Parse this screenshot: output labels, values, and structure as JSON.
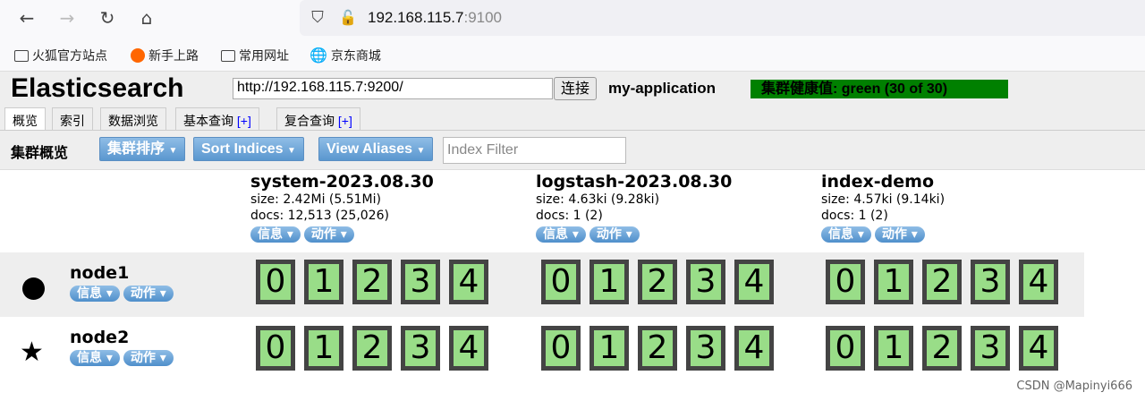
{
  "browser": {
    "url_host": "192.168.115.7",
    "url_port": ":9100",
    "bookmarks": [
      "火狐官方站点",
      "新手上路",
      "常用网址",
      "京东商城"
    ]
  },
  "app": {
    "title": "Elasticsearch",
    "connect_url": "http://192.168.115.7:9200/",
    "connect_label": "连接",
    "cluster_name": "my-application",
    "health": "集群健康值: green (30 of 30)",
    "health_color": "#008000"
  },
  "tabs": [
    {
      "label": "概览"
    },
    {
      "label": "索引"
    },
    {
      "label": "数据浏览"
    },
    {
      "label": "基本查询",
      "plus": "[+]"
    },
    {
      "label": "复合查询",
      "plus": "[+]"
    }
  ],
  "toolbar": {
    "title": "集群概览",
    "sort_cluster": "集群排序",
    "sort_indices": "Sort Indices",
    "view_aliases": "View Aliases",
    "filter_placeholder": "Index Filter"
  },
  "menu": {
    "info": "信息",
    "action": "动作"
  },
  "indices": [
    {
      "name": "system-2023.08.30",
      "size": "size: 2.42Mi (5.51Mi)",
      "docs": "docs: 12,513 (25,026)"
    },
    {
      "name": "logstash-2023.08.30",
      "size": "size: 4.63ki (9.28ki)",
      "docs": "docs: 1 (2)"
    },
    {
      "name": "index-demo",
      "size": "size: 4.57ki (9.14ki)",
      "docs": "docs: 1 (2)"
    }
  ],
  "nodes": [
    {
      "name": "node1",
      "icon": "circle"
    },
    {
      "name": "node2",
      "icon": "star"
    }
  ],
  "shards": [
    "0",
    "1",
    "2",
    "3",
    "4"
  ],
  "watermark": "CSDN @Mapinyi666"
}
